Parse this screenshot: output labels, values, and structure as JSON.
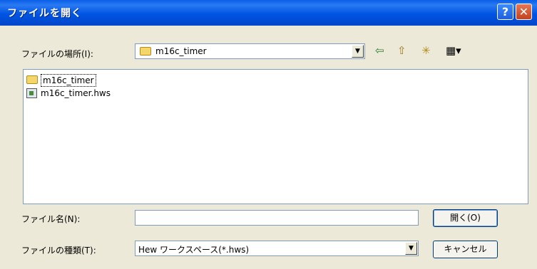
{
  "window": {
    "title": "ファイルを開く",
    "help_glyph": "?",
    "close_glyph": "✕"
  },
  "location": {
    "label": "ファイルの場所(I):",
    "value": "m16c_timer"
  },
  "toolbar": {
    "back_glyph": "⇦",
    "up_glyph": "⇧",
    "new_folder_glyph": "✳",
    "view_glyph": "▦▾"
  },
  "files": [
    {
      "name": "m16c_timer",
      "type": "folder"
    },
    {
      "name": "m16c_timer.hws",
      "type": "workspace"
    }
  ],
  "filename": {
    "label": "ファイル名(N):",
    "value": ""
  },
  "filetype": {
    "label": "ファイルの種類(T):",
    "value": "Hew ワークスペース(*.hws)"
  },
  "buttons": {
    "open": "開く(O)",
    "cancel": "キャンセル"
  },
  "icons": {
    "dropdown": "▼"
  },
  "colors": {
    "titlebar": "#0054e3",
    "dialog_bg": "#ece9d8"
  }
}
